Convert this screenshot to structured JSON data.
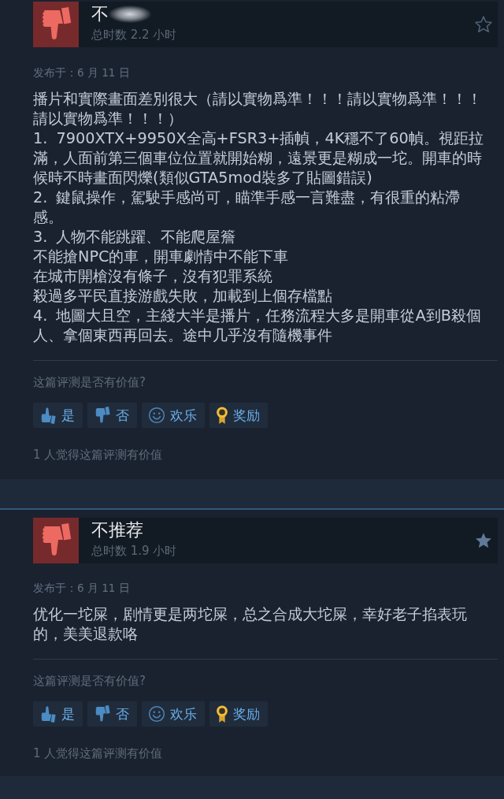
{
  "reviews": [
    {
      "recommended": false,
      "title": "不",
      "title_blurred": true,
      "hours": "总时数 2.2 小时",
      "starred": false,
      "posted": "发布于：6 月 11 日",
      "body": [
        "播片和實際畫面差別很大（請以實物爲準！！！請以實物爲準！！！請以實物爲準！！！）",
        "1. 7900XTX+9950X全高+FSR3+插幀，4K穩不了60幀。視距拉滿，人面前第三個車位位置就開始糊，遠景更是糊成一坨。開車的時候時不時畫面閃爍(類似GTA5mod裝多了貼圖錯誤)",
        "2. 鍵鼠操作，駕駛手感尚可，瞄準手感一言難盡，有很重的粘滯感。",
        "3. 人物不能跳躍、不能爬屋簷",
        "不能搶NPC的車，開車劇情中不能下車",
        "在城市開槍沒有條子，沒有犯罪系統",
        "殺過多平民直接游戲失敗，加載到上個存檔點",
        "4. 地圖大且空，主綫大半是播片，任務流程大多是開車從A到B殺個人、拿個東西再回去。途中几乎沒有隨機事件"
      ],
      "helpful_question": "这篇评测是否有价值?",
      "buttons": [
        {
          "kind": "yes",
          "label": "是"
        },
        {
          "kind": "no",
          "label": "否"
        },
        {
          "kind": "funny",
          "label": "欢乐"
        },
        {
          "kind": "award",
          "label": "奖励"
        }
      ],
      "helpful_count": "1 人觉得这篇评测有价值"
    },
    {
      "recommended": false,
      "title": "不推荐",
      "title_blurred": false,
      "hours": "总时数 1.9 小时",
      "starred": true,
      "posted": "发布于：6 月 11 日",
      "body": [
        "优化一坨屎，剧情更是两坨屎，总之合成大坨屎，幸好老子掐表玩的，美美退款咯"
      ],
      "helpful_question": "这篇评测是否有价值?",
      "buttons": [
        {
          "kind": "yes",
          "label": "是"
        },
        {
          "kind": "no",
          "label": "否"
        },
        {
          "kind": "funny",
          "label": "欢乐"
        },
        {
          "kind": "award",
          "label": "奖励"
        }
      ],
      "helpful_count": "1 人觉得这篇评测有价值"
    }
  ]
}
